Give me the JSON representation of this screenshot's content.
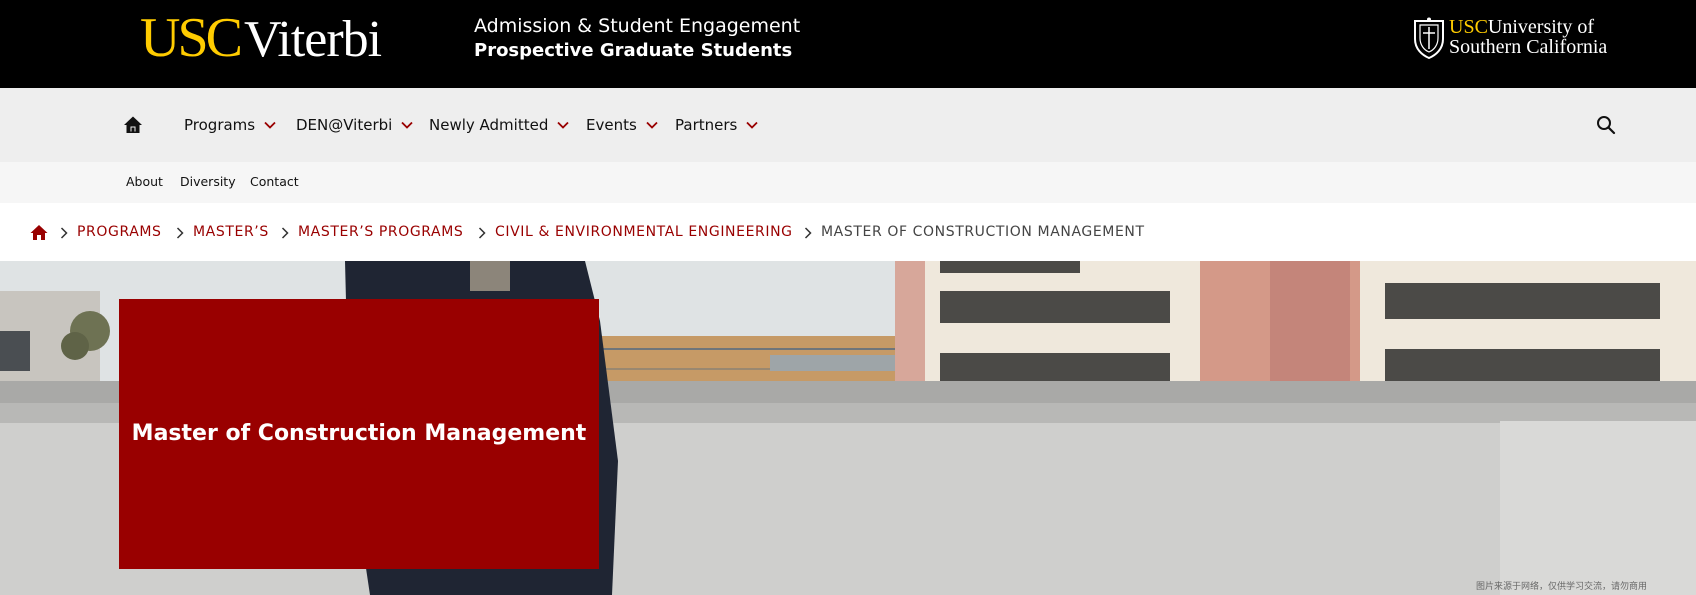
{
  "header": {
    "logo_usc": "USC",
    "logo_viterbi": "Viterbi",
    "unit_line1": "Admission & Student Engagement",
    "unit_line2": "Prospective Graduate Students",
    "usc_logo_usc": "USC",
    "usc_logo_line1": "University of",
    "usc_logo_line2": "Southern California"
  },
  "main_nav": {
    "home_icon": "home-icon",
    "items": [
      {
        "label": "Programs"
      },
      {
        "label": "DEN@Viterbi"
      },
      {
        "label": "Newly Admitted"
      },
      {
        "label": "Events"
      },
      {
        "label": "Partners"
      }
    ],
    "search_icon": "search-icon"
  },
  "utility_nav": {
    "items": [
      {
        "label": "About"
      },
      {
        "label": "Diversity"
      },
      {
        "label": "Contact"
      }
    ]
  },
  "breadcrumb": {
    "home_icon": "home-icon",
    "items": [
      {
        "label": "PROGRAMS"
      },
      {
        "label": "MASTER’S"
      },
      {
        "label": "MASTER’S PROGRAMS"
      },
      {
        "label": "CIVIL & ENVIRONMENTAL ENGINEERING"
      },
      {
        "label": "MASTER OF CONSTRUCTION MANAGEMENT"
      }
    ]
  },
  "hero": {
    "title": "Master of Construction Management",
    "watermark": "图片来源于网络，仅供学习交流，请勿商用"
  },
  "colors": {
    "brand_cardinal": "#990000",
    "brand_gold": "#ffcc00",
    "header_bg": "#000000",
    "nav_bg": "#eeeeee",
    "util_bg": "#f6f6f6"
  }
}
